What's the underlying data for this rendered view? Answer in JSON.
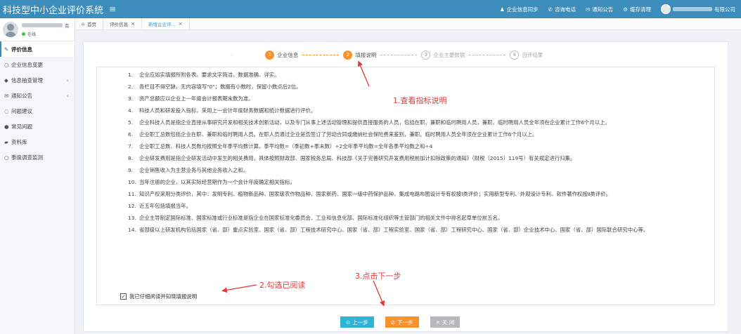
{
  "topbar": {
    "title": "科技型中小企业评价系统",
    "nav": [
      {
        "icon": "person-icon",
        "label": "企业信息同步"
      },
      {
        "icon": "phone-icon",
        "label": "咨询电话"
      },
      {
        "icon": "envelope-icon",
        "label": "通知公告"
      },
      {
        "icon": "gear-icon",
        "label": "缓存清理"
      }
    ],
    "company_suffix": "有限公司"
  },
  "user": {
    "name_suffix": "有",
    "status": "在线"
  },
  "sidebar": {
    "items": [
      {
        "icon": "edit-icon",
        "label": "评价信息",
        "active": true,
        "chevron": false
      },
      {
        "icon": "circle-icon",
        "label": "企业信息变更",
        "chevron": false
      },
      {
        "icon": "tag-icon",
        "label": "信息抽查管理",
        "chevron": true
      },
      {
        "icon": "envelope-icon",
        "label": "通知公告",
        "chevron": true
      },
      {
        "icon": "chat-icon",
        "label": "问题建议",
        "chevron": false
      },
      {
        "icon": "question-icon",
        "label": "常见问题",
        "chevron": false
      },
      {
        "icon": "folder-icon",
        "label": "资料库",
        "chevron": false
      },
      {
        "icon": "circle-icon",
        "label": "季度调查监测",
        "chevron": false
      }
    ]
  },
  "tabs": [
    {
      "icon": "home-icon",
      "label": "首页",
      "closable": false
    },
    {
      "label": "评价信息",
      "closable": true
    },
    {
      "label": "新增企业评...",
      "closable": true,
      "active": true
    }
  ],
  "steps": [
    {
      "num": "1",
      "label": "企业信息",
      "state": "done"
    },
    {
      "num": "2",
      "label": "填报说明",
      "state": "done"
    },
    {
      "num": "3",
      "label": "企业主要数据",
      "state": "todo"
    },
    {
      "num": "4",
      "label": "自评结果",
      "state": "todo"
    }
  ],
  "steps_lead": "·",
  "notes": [
    {
      "num": "1.",
      "text": "企业应如实填报所附各表。要求文字简洁，数据准确、详实。"
    },
    {
      "num": "2.",
      "text": "各栏目不得空缺，无内容填写\"0\"；数据有小数时，保留小数点后2位。"
    },
    {
      "num": "3.",
      "text": "资产总额应以企业上一年度会计报表期末数为准。"
    },
    {
      "num": "4.",
      "text": "科技人员和研发投入指标，采用上一会计年度财务数据和统计数据进行评价。"
    },
    {
      "num": "5.",
      "text": "企业科技人员是指企业直接从事研究开发和相关技术创新活动，以及专门从事上述活动管理和提供直接服务的人员，包括在职、兼职和临时聘用人员，兼职、临时聘用人员全年须在企业累计工作6个月以上。"
    },
    {
      "num": "6.",
      "text": "企业职工总数包括企业在职、兼职和临时聘用人员。在职人员通过企业是否签订了劳动合同或缴纳社会保险费来鉴别，兼职、临时聘用人员全年须在企业累计工作6个月以上。"
    },
    {
      "num": "7.",
      "text": "企业职工总数、科技人员数均按照全年季平均数计算。季平均数=（季初数+季末数）÷2全年季平均数=全年各季平均数之和÷4"
    },
    {
      "num": "8.",
      "text": "企业研发费用是指企业研发活动中发生的相关费用，具体按照财政部、国家税务总局、科技部《关于完善研究开发费用税前加计扣除政策的通知》（财税〔2015〕119号）有关规定进行归集。"
    },
    {
      "num": "9.",
      "text": "企业销售收入为主营业务与其他业务收入之和。"
    },
    {
      "num": "10.",
      "text": "当年注册的企业，以其实际经营期作为一个会计年度确定相关指标。"
    },
    {
      "num": "11.",
      "text": "知识产权采用分类评价，其中：发明专利、植物新品种、国家级农作物品种、国家新药、国家一级中药保护品种、集成电路布图设计专有权按Ⅰ类评价；实用新型专利、外观设计专利、软件著作权按Ⅱ类评价。"
    },
    {
      "num": "12.",
      "text": "近五年包括填报当年。"
    },
    {
      "num": "13.",
      "text": "企业主导制定国际标准、国家标准或行业标准是指企业在国家标准化委员会、工业和信息化部、国际标准化组织等主管部门的相关文件中排名起草单位前五名。"
    },
    {
      "num": "14.",
      "text": "省部级以上研发机构包括国家（省、部）重点实验室、国家（省、部）工程技术研究中心、国家（省、部）工程实验室、国家（省、部）工程研究中心、国家（省、部）企业技术中心、国家（省、部）国际联合研究中心等。"
    }
  ],
  "agree": {
    "checked": true,
    "label": "我已仔细阅读并知晓填报说明"
  },
  "annotations": {
    "a1": "1.查看指标说明",
    "a2": "2.勾选已阅读",
    "a3": "3.点击下一步"
  },
  "buttons": {
    "prev": {
      "icon": "prev-circle-icon",
      "label": "上一步"
    },
    "next": {
      "icon": "next-circle-icon",
      "label": "下一步"
    },
    "close": {
      "icon": "close-icon",
      "label": "关 闭"
    }
  },
  "colors": {
    "topbar": "#3c8dbc",
    "step_active": "#f7922c",
    "annotation": "#e03a3a",
    "btn_prev": "#30b4d6",
    "btn_next": "#f7922c",
    "btn_close": "#b5b9be"
  }
}
